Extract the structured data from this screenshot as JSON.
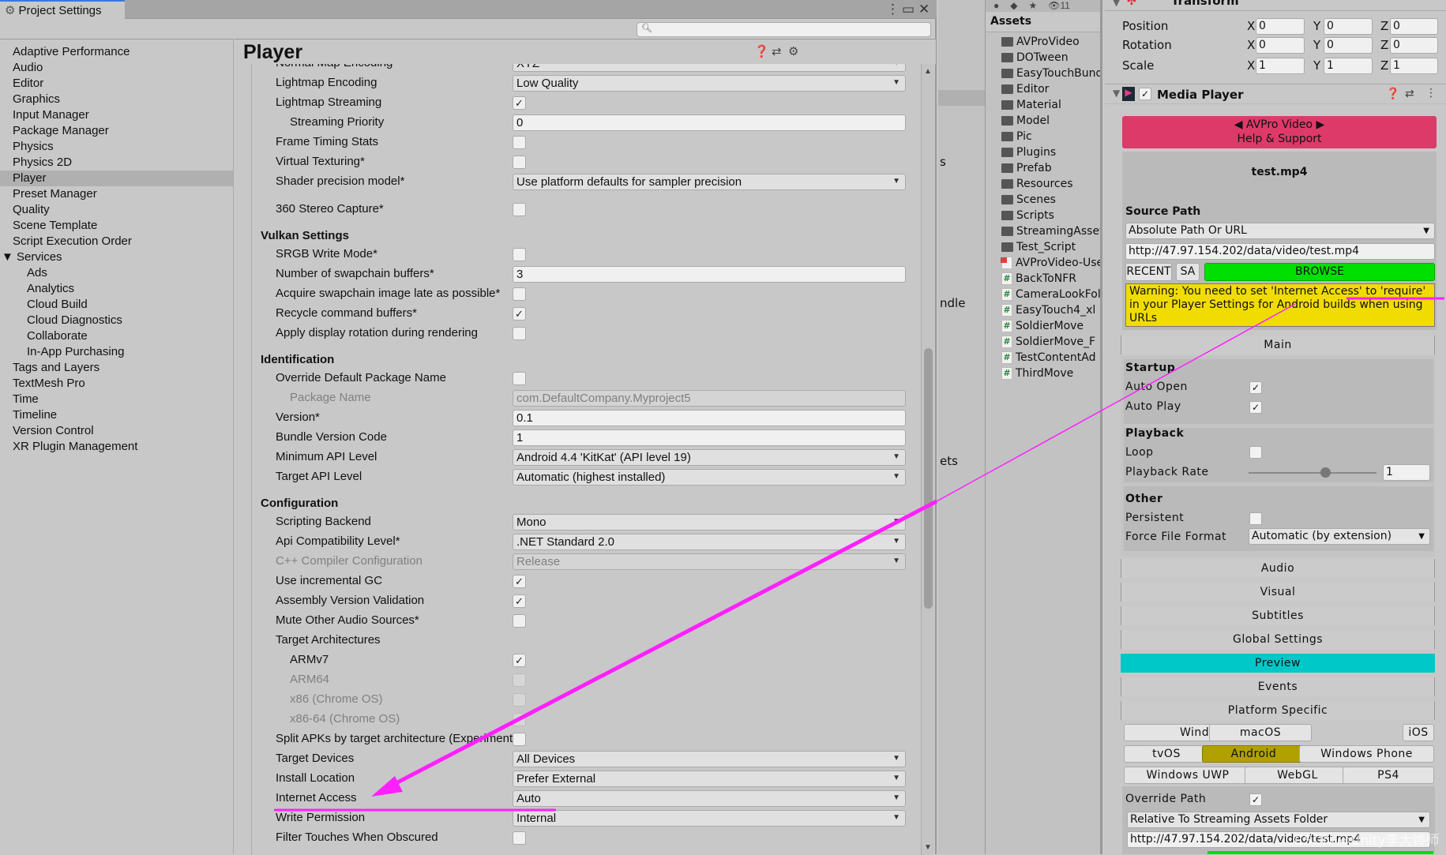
{
  "project_settings": {
    "tab_title": "Project Settings",
    "search_placeholder": "",
    "sidebar": [
      {
        "label": "Adaptive Performance"
      },
      {
        "label": "Audio"
      },
      {
        "label": "Editor"
      },
      {
        "label": "Graphics"
      },
      {
        "label": "Input Manager"
      },
      {
        "label": "Package Manager"
      },
      {
        "label": "Physics"
      },
      {
        "label": "Physics 2D"
      },
      {
        "label": "Player",
        "selected": true
      },
      {
        "label": "Preset Manager"
      },
      {
        "label": "Quality"
      },
      {
        "label": "Scene Template"
      },
      {
        "label": "Script Execution Order"
      },
      {
        "label": "▼ Services",
        "expanded": true
      },
      {
        "label": "Ads",
        "sub": true
      },
      {
        "label": "Analytics",
        "sub": true
      },
      {
        "label": "Cloud Build",
        "sub": true
      },
      {
        "label": "Cloud Diagnostics",
        "sub": true
      },
      {
        "label": "Collaborate",
        "sub": true
      },
      {
        "label": "In-App Purchasing",
        "sub": true
      },
      {
        "label": "Tags and Layers"
      },
      {
        "label": "TextMesh Pro"
      },
      {
        "label": "Time"
      },
      {
        "label": "Timeline"
      },
      {
        "label": "Version Control"
      },
      {
        "label": "XR Plugin Management"
      }
    ],
    "page_title": "Player",
    "rows": [
      {
        "label": "Normal Map Encoding",
        "type": "dropdown",
        "value": "XYZ"
      },
      {
        "label": "Lightmap Encoding",
        "type": "dropdown",
        "value": "Low Quality"
      },
      {
        "label": "Lightmap Streaming",
        "type": "check",
        "checked": true
      },
      {
        "label": "Streaming Priority",
        "type": "text",
        "value": "0",
        "indent": 1
      },
      {
        "label": "Frame Timing Stats",
        "type": "check",
        "checked": false
      },
      {
        "label": "Virtual Texturing*",
        "type": "check",
        "checked": false
      },
      {
        "label": "Shader precision model*",
        "type": "dropdown",
        "value": "Use platform defaults for sampler precision"
      },
      {
        "label": "360 Stereo Capture*",
        "type": "check",
        "checked": false
      },
      {
        "label": "Vulkan Settings",
        "type": "header"
      },
      {
        "label": "SRGB Write Mode*",
        "type": "check",
        "checked": false
      },
      {
        "label": "Number of swapchain buffers*",
        "type": "text",
        "value": "3"
      },
      {
        "label": "Acquire swapchain image late as possible*",
        "type": "check",
        "checked": false
      },
      {
        "label": "Recycle command buffers*",
        "type": "check",
        "checked": true
      },
      {
        "label": "Apply display rotation during rendering",
        "type": "check",
        "checked": false
      },
      {
        "label": "Identification",
        "type": "header"
      },
      {
        "label": "Override Default Package Name",
        "type": "check",
        "checked": false
      },
      {
        "label": "Package Name",
        "type": "text",
        "value": "com.DefaultCompany.Myproject5",
        "indent": 1,
        "disabled": true
      },
      {
        "label": "Version*",
        "type": "text",
        "value": "0.1"
      },
      {
        "label": "Bundle Version Code",
        "type": "text",
        "value": "1"
      },
      {
        "label": "Minimum API Level",
        "type": "dropdown",
        "value": "Android 4.4 'KitKat' (API level 19)"
      },
      {
        "label": "Target API Level",
        "type": "dropdown",
        "value": "Automatic (highest installed)"
      },
      {
        "label": "Configuration",
        "type": "header"
      },
      {
        "label": "Scripting Backend",
        "type": "dropdown",
        "value": "Mono"
      },
      {
        "label": "Api Compatibility Level*",
        "type": "dropdown",
        "value": ".NET Standard 2.0"
      },
      {
        "label": "C++ Compiler Configuration",
        "type": "dropdown",
        "value": "Release",
        "disabled": true
      },
      {
        "label": "Use incremental GC",
        "type": "check",
        "checked": true
      },
      {
        "label": "Assembly Version Validation",
        "type": "check",
        "checked": true
      },
      {
        "label": "Mute Other Audio Sources*",
        "type": "check",
        "checked": false
      },
      {
        "label": "Target Architectures",
        "type": "label"
      },
      {
        "label": "ARMv7",
        "type": "check",
        "checked": true,
        "indent": 1
      },
      {
        "label": "ARM64",
        "type": "check",
        "checked": false,
        "indent": 1,
        "disabled": true
      },
      {
        "label": "x86 (Chrome OS)",
        "type": "check",
        "checked": false,
        "indent": 1,
        "disabled": true
      },
      {
        "label": "x86-64 (Chrome OS)",
        "type": "check",
        "checked": false,
        "indent": 1,
        "disabled": true
      },
      {
        "label": "Split APKs by target architecture (Experimental)",
        "type": "check",
        "checked": false
      },
      {
        "label": "Target Devices",
        "type": "dropdown",
        "value": "All Devices"
      },
      {
        "label": "Install Location",
        "type": "dropdown",
        "value": "Prefer External"
      },
      {
        "label": "Internet Access",
        "type": "dropdown",
        "value": "Auto"
      },
      {
        "label": "Write Permission",
        "type": "dropdown",
        "value": "Internal"
      },
      {
        "label": "Filter Touches When Obscured",
        "type": "check",
        "checked": false
      }
    ]
  },
  "hidden_panel_fragments": [
    "s",
    "ndle",
    "ets"
  ],
  "assets": {
    "toolbar_hidden_count": "11",
    "title": "Assets",
    "items": [
      {
        "name": "AVProVideo",
        "icon": "folder"
      },
      {
        "name": "DOTween",
        "icon": "folder"
      },
      {
        "name": "EasyTouchBundle",
        "icon": "folder"
      },
      {
        "name": "Editor",
        "icon": "folder"
      },
      {
        "name": "Material",
        "icon": "folder"
      },
      {
        "name": "Model",
        "icon": "folder"
      },
      {
        "name": "Pic",
        "icon": "folder"
      },
      {
        "name": "Plugins",
        "icon": "folder"
      },
      {
        "name": "Prefab",
        "icon": "folder"
      },
      {
        "name": "Resources",
        "icon": "folder"
      },
      {
        "name": "Scenes",
        "icon": "folder"
      },
      {
        "name": "Scripts",
        "icon": "folder"
      },
      {
        "name": "StreamingAssets",
        "icon": "folder"
      },
      {
        "name": "Test_Script",
        "icon": "folder"
      },
      {
        "name": "AVProVideo-UserManual",
        "icon": "pdf"
      },
      {
        "name": "BackToNFR",
        "icon": "script"
      },
      {
        "name": "CameraLookFollow",
        "icon": "script"
      },
      {
        "name": "EasyTouch4_xl",
        "icon": "script"
      },
      {
        "name": "SoldierMove",
        "icon": "script"
      },
      {
        "name": "SoldierMove_F",
        "icon": "script"
      },
      {
        "name": "TestContentAd",
        "icon": "script"
      },
      {
        "name": "ThirdMove",
        "icon": "script"
      }
    ]
  },
  "inspector": {
    "transform": {
      "title": "Transform",
      "rows": [
        {
          "label": "Position",
          "x": "0",
          "y": "0",
          "z": "0"
        },
        {
          "label": "Rotation",
          "x": "0",
          "y": "0",
          "z": "0"
        },
        {
          "label": "Scale",
          "x": "1",
          "y": "1",
          "z": "1"
        }
      ],
      "axes": [
        "X",
        "Y",
        "Z"
      ]
    },
    "media_player": {
      "title": "Media Player",
      "enabled": true,
      "banner_line1": "◀ AVPro Video ▶",
      "banner_line2": "Help & Support",
      "file_name": "test.mp4",
      "source_path_label": "Source Path",
      "source_path_mode": "Absolute Path Or URL",
      "url": "http://47.97.154.202/data/video/test.mp4",
      "recent_button": "RECENT",
      "sa_button": "SA",
      "browse_button": "BROWSE",
      "warning": "Warning: You need to set 'Internet Access' to 'require' in your Player Settings for Android builds when using URLs",
      "main_label": "Main",
      "startup_title": "Startup",
      "auto_open_label": "Auto Open",
      "auto_open": true,
      "auto_play_label": "Auto Play",
      "auto_play": true,
      "playback_title": "Playback",
      "loop_label": "Loop",
      "loop": false,
      "playback_rate_label": "Playback Rate",
      "playback_rate": "1",
      "playback_rate_slider_fraction": 0.6,
      "other_title": "Other",
      "persistent_label": "Persistent",
      "persistent": false,
      "force_file_format_label": "Force File Format",
      "force_file_format": "Automatic (by extension)",
      "sections": [
        "Audio",
        "Visual",
        "Subtitles",
        "Global Settings",
        "Preview",
        "Events",
        "Platform Specific"
      ],
      "active_section": "Preview",
      "platforms_row1": [
        "Windows",
        "macOS",
        "iOS"
      ],
      "platforms_row2": [
        "tvOS",
        "Android",
        "Windows Phone"
      ],
      "platforms_row3": [
        "Windows UWP",
        "WebGL",
        "PS4"
      ],
      "active_platform": "Android",
      "override_path_label": "Override Path",
      "override_path": true,
      "override_mode": "Relative To Streaming Assets Folder",
      "override_url": "http://47.97.154.202/data/video/test.mp4"
    }
  },
  "watermark": "CSDN @Unity李大馋师",
  "colors": {
    "banner": "#dd3a6a",
    "browse": "#00e000",
    "warning": "#f0dc00",
    "preview": "#00c8c8",
    "android": "#b0a000",
    "annotation": "#ff20ff"
  }
}
